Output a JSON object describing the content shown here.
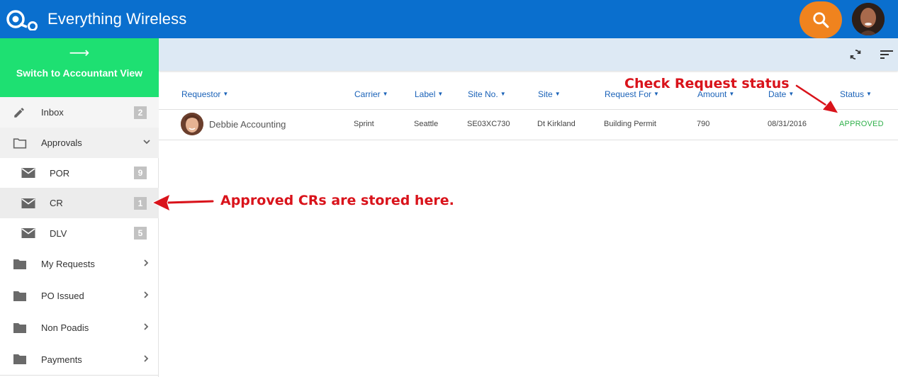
{
  "app": {
    "title": "Everything Wireless"
  },
  "sidebar": {
    "switch_label": "Switch to Accountant View",
    "switch_arrow": "⟶",
    "items": [
      {
        "label": "Inbox",
        "badge": "2",
        "icon": "pencil-icon"
      },
      {
        "label": "Approvals",
        "icon": "folder-outline-icon",
        "expanded": true
      },
      {
        "label": "POR",
        "badge": "9",
        "icon": "mail-icon"
      },
      {
        "label": "CR",
        "badge": "1",
        "icon": "mail-icon",
        "selected": true
      },
      {
        "label": "DLV",
        "badge": "5",
        "icon": "mail-icon"
      },
      {
        "label": "My Requests",
        "icon": "folder-icon"
      },
      {
        "label": "PO Issued",
        "icon": "folder-icon"
      },
      {
        "label": "Non Poadis",
        "icon": "folder-icon"
      },
      {
        "label": "Payments",
        "icon": "folder-icon"
      }
    ]
  },
  "table": {
    "columns": [
      "Requestor",
      "Carrier",
      "Label",
      "Site No.",
      "Site",
      "Request For",
      "Amount",
      "Date",
      "Status"
    ],
    "rows": [
      {
        "requestor": "Debbie Accounting",
        "carrier": "Sprint",
        "label": "Seattle",
        "site_no": "SE03XC730",
        "site": "Dt Kirkland",
        "request_for": "Building Permit",
        "amount": "790",
        "date": "08/31/2016",
        "status": "APPROVED"
      }
    ]
  },
  "annotations": {
    "status_note": "Check Request status",
    "cr_note": "Approved CRs are stored here."
  },
  "colors": {
    "topbar": "#0a6fce",
    "switch_view": "#1ee072",
    "search_button": "#f0831e",
    "status_approved": "#2fb04a",
    "annotation": "#d9131b"
  }
}
